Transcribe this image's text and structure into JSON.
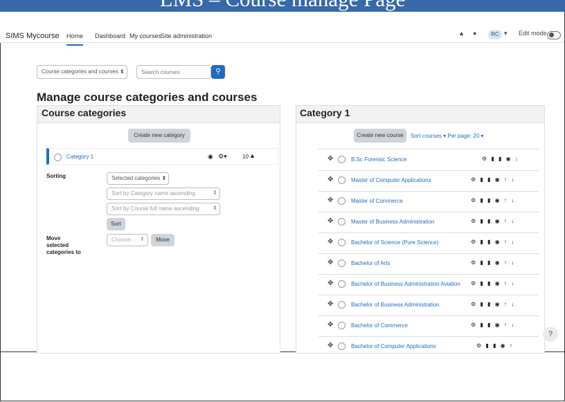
{
  "banner": {
    "title": "LMS – Course manage Page"
  },
  "navbar": {
    "brand": "SIMS Mycourse",
    "links": [
      "Home",
      "Dashboard",
      "My courses",
      "Site administration"
    ],
    "user_initials": "RC",
    "caret": "▾",
    "edit_mode_label": "Edit mode"
  },
  "toolbar": {
    "view_select": "Course categories and courses ⬍",
    "search_placeholder": "Search courses"
  },
  "page_title": "Manage course categories and courses",
  "categories_panel": {
    "title": "Course categories",
    "create_button": "Create new category",
    "category": {
      "name": "Category 1",
      "count": "10"
    },
    "sorting_label": "Sorting",
    "sort_selected": "Selected categories ⬍",
    "sort_by_name": "Sort by Category name ascending",
    "sort_by_course": "Sort by Course full name ascending",
    "sort_button": "Sort",
    "move_label_1": "Move",
    "move_label_2": "selected",
    "move_label_3": "categories to",
    "choose": "Choose...",
    "move_button": "Move"
  },
  "courses_panel": {
    "title": "Category 1",
    "create_button": "Create new course",
    "sort_link": "Sort courses",
    "per_page": "Per page: 20",
    "courses": [
      {
        "name": "B.Sc Forensic Science",
        "actions": "⚙ ▮ ▮ ◉ ↓"
      },
      {
        "name": "Master of Computer Applications",
        "actions": "⚙ ▮ ▮ ◉ ↑ ↓"
      },
      {
        "name": "Master of Commerce",
        "actions": "⚙ ▮ ▮ ◉ ↑ ↓"
      },
      {
        "name": "Master of Business Administration",
        "actions": "⚙ ▮ ▮ ◉ ↑ ↓"
      },
      {
        "name": "Bachelor of Science (Pure Science)",
        "actions": "⚙ ▮ ▮ ◉ ↑ ↓"
      },
      {
        "name": "Bachelor of Arts",
        "actions": "⚙ ▮ ▮ ◉ ↑ ↓"
      },
      {
        "name": "Bachelor of Business Administration Aviation",
        "actions": "⚙ ▮ ▮ ◉ ↑ ↓"
      },
      {
        "name": "Bachelor of Business Administration",
        "actions": "⚙ ▮ ▮ ◉ ↑ ↓"
      },
      {
        "name": "Bachelor of Commerce",
        "actions": "⚙ ▮ ▮ ◉ ↑ ↓"
      },
      {
        "name": "Bachelor of Computer Applications",
        "actions": "⚙ ▮ ▮ ◉ ↑"
      }
    ]
  },
  "help": "?",
  "colors": {
    "banner": "#3768a8",
    "accent": "#1f6bbd"
  }
}
